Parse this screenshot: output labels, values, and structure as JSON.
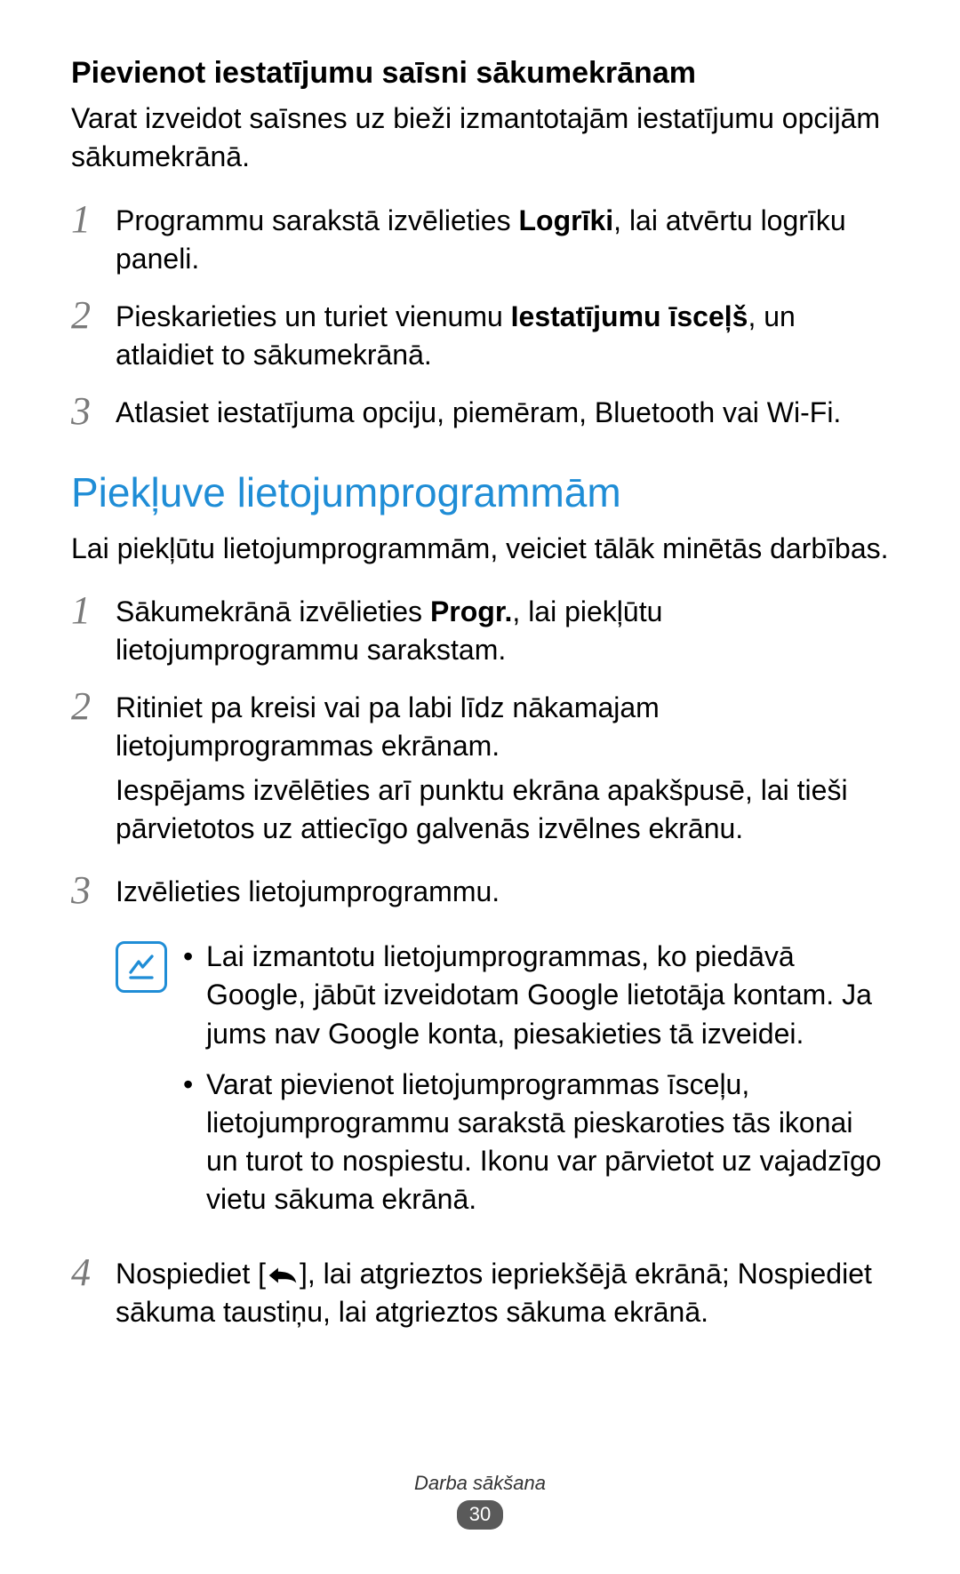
{
  "section1": {
    "title": "Pievienot iestatījumu saīsni sākumekrānam",
    "intro": "Varat izveidot saīsnes uz bieži izmantotajām iestatījumu opcijām sākumekrānā.",
    "steps": [
      {
        "num": "1",
        "parts": [
          "Programmu sarakstā izvēlieties ",
          "Logrīki",
          ", lai atvērtu logrīku paneli."
        ]
      },
      {
        "num": "2",
        "parts": [
          "Pieskarieties un turiet vienumu ",
          "Iestatījumu īsceļš",
          ", un atlaidiet to sākumekrānā."
        ]
      },
      {
        "num": "3",
        "text": "Atlasiet iestatījuma opciju, piemēram, Bluetooth vai Wi-Fi."
      }
    ]
  },
  "section2": {
    "heading": "Piekļuve lietojumprogrammām",
    "intro": "Lai piekļūtu lietojumprogrammām, veiciet tālāk minētās darbības.",
    "steps": [
      {
        "num": "1",
        "parts": [
          "Sākumekrānā izvēlieties ",
          "Progr.",
          ", lai piekļūtu lietojumprogrammu sarakstam."
        ]
      },
      {
        "num": "2",
        "p1": "Ritiniet pa kreisi vai pa labi līdz nākamajam lietojumprogrammas ekrānam.",
        "p2": "Iespējams izvēlēties arī punktu ekrāna apakšpusē, lai tieši pārvietotos uz attiecīgo galvenās izvēlnes ekrānu."
      },
      {
        "num": "3",
        "text": "Izvēlieties lietojumprogrammu."
      }
    ],
    "note": {
      "items": [
        "Lai izmantotu lietojumprogrammas, ko piedāvā Google, jābūt izveidotam Google lietotāja kontam. Ja jums nav Google konta, piesakieties tā izveidei.",
        "Varat pievienot lietojumprogrammas īsceļu, lietojumprogrammu sarakstā pieskaroties tās ikonai un turot to nospiestu. Ikonu var pārvietot uz vajadzīgo vietu sākuma ekrānā."
      ]
    },
    "step4": {
      "num": "4",
      "pre": "Nospiediet [",
      "post": "], lai atgrieztos iepriekšējā ekrānā; Nospiediet sākuma taustiņu, lai atgrieztos sākuma ekrānā."
    }
  },
  "footer": {
    "label": "Darba sākšana",
    "page": "30"
  }
}
